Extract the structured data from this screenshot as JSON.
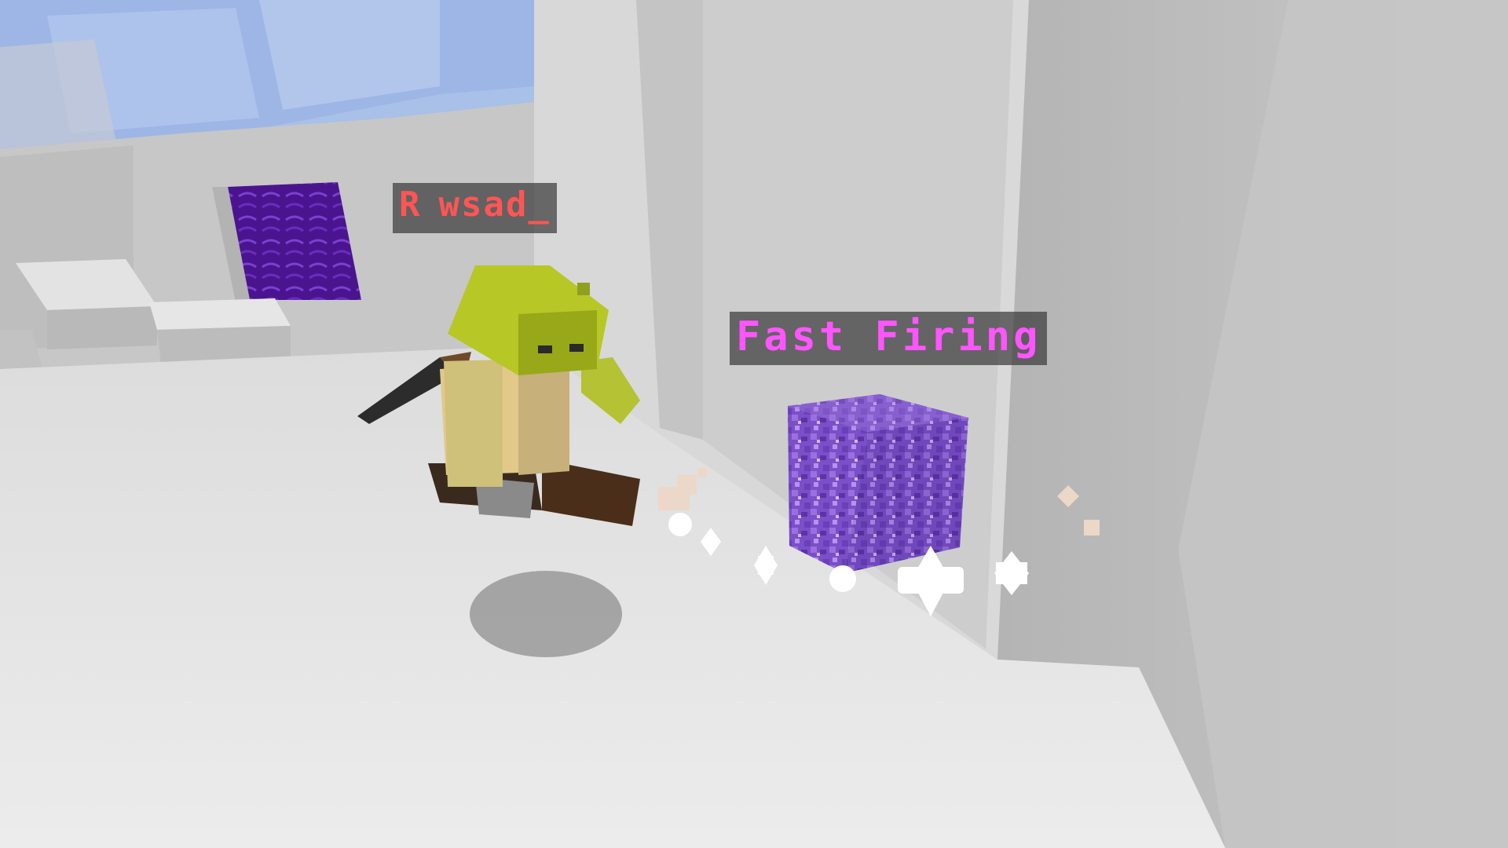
{
  "player": {
    "rank_prefix": "R",
    "username": "wsad_",
    "color": "#ff5555"
  },
  "powerup": {
    "label": "Fast Firing",
    "color": "#ff55ff",
    "block": "amethyst-block"
  },
  "colors": {
    "sky": "#9fb9e6",
    "portal": "#5a1fa8",
    "wall": "#bdbdbd",
    "floor": "#e6e6e6"
  }
}
